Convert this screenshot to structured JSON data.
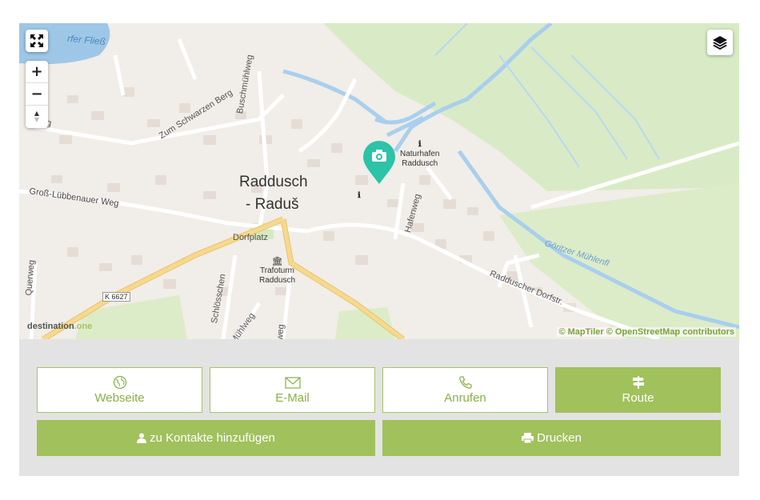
{
  "map": {
    "place_name": "Raddusch\n- Raduš",
    "place_line1": "Raddusch",
    "place_line2": "- Raduš",
    "labels": {
      "gross_luebbenauer_weg": "Groß-Lübbenauer Weg",
      "zum_schwarzen_berg": "Zum Schwarzen Berg",
      "buschmuehlweg": "Buschmühlweg",
      "dorfplatz": "Dorfplatz",
      "hafenweg": "Hafenweg",
      "radduscher_dorfstr": "Radduscher Dorfstr.",
      "goeritzer_muehlenfliess": "Göritzer Mühlenfl",
      "querweg": "Querweg",
      "schloesschen": "Schlösschen",
      "muehlweg": "Mühlweg",
      "weg_bottom": "weg",
      "weg_left": "weg",
      "fliess_top": "rfer Fließ",
      "road_k6627": "K 6627"
    },
    "pois": {
      "naturhafen": "Naturhafen\nRaddusch",
      "naturhafen_line1": "Naturhafen",
      "naturhafen_line2": "Raddusch",
      "trafoturm_line1": "Trafoturm",
      "trafoturm_line2": "Raddusch"
    },
    "controls": {
      "zoom_in": "+",
      "zoom_out": "−",
      "compass": "▲▼",
      "fullscreen_icon": "fullscreen-icon",
      "layers_icon": "layers-icon"
    },
    "attribution": "© MapTiler © OpenStreetMap contributors",
    "logo_text": "destination",
    "logo_tag": ".one",
    "marker_color": "#2cc3a8"
  },
  "actions": {
    "website": "Webseite",
    "email": "E-Mail",
    "call": "Anrufen",
    "route": "Route",
    "add_contact": "zu Kontakte hinzufügen",
    "print": "Drucken"
  },
  "colors": {
    "accent": "#a0c15c",
    "panel_bg": "#e3e3e3",
    "water": "#8fc0e6",
    "park": "#d9ebc6",
    "road_yellow": "#f6d98e"
  }
}
